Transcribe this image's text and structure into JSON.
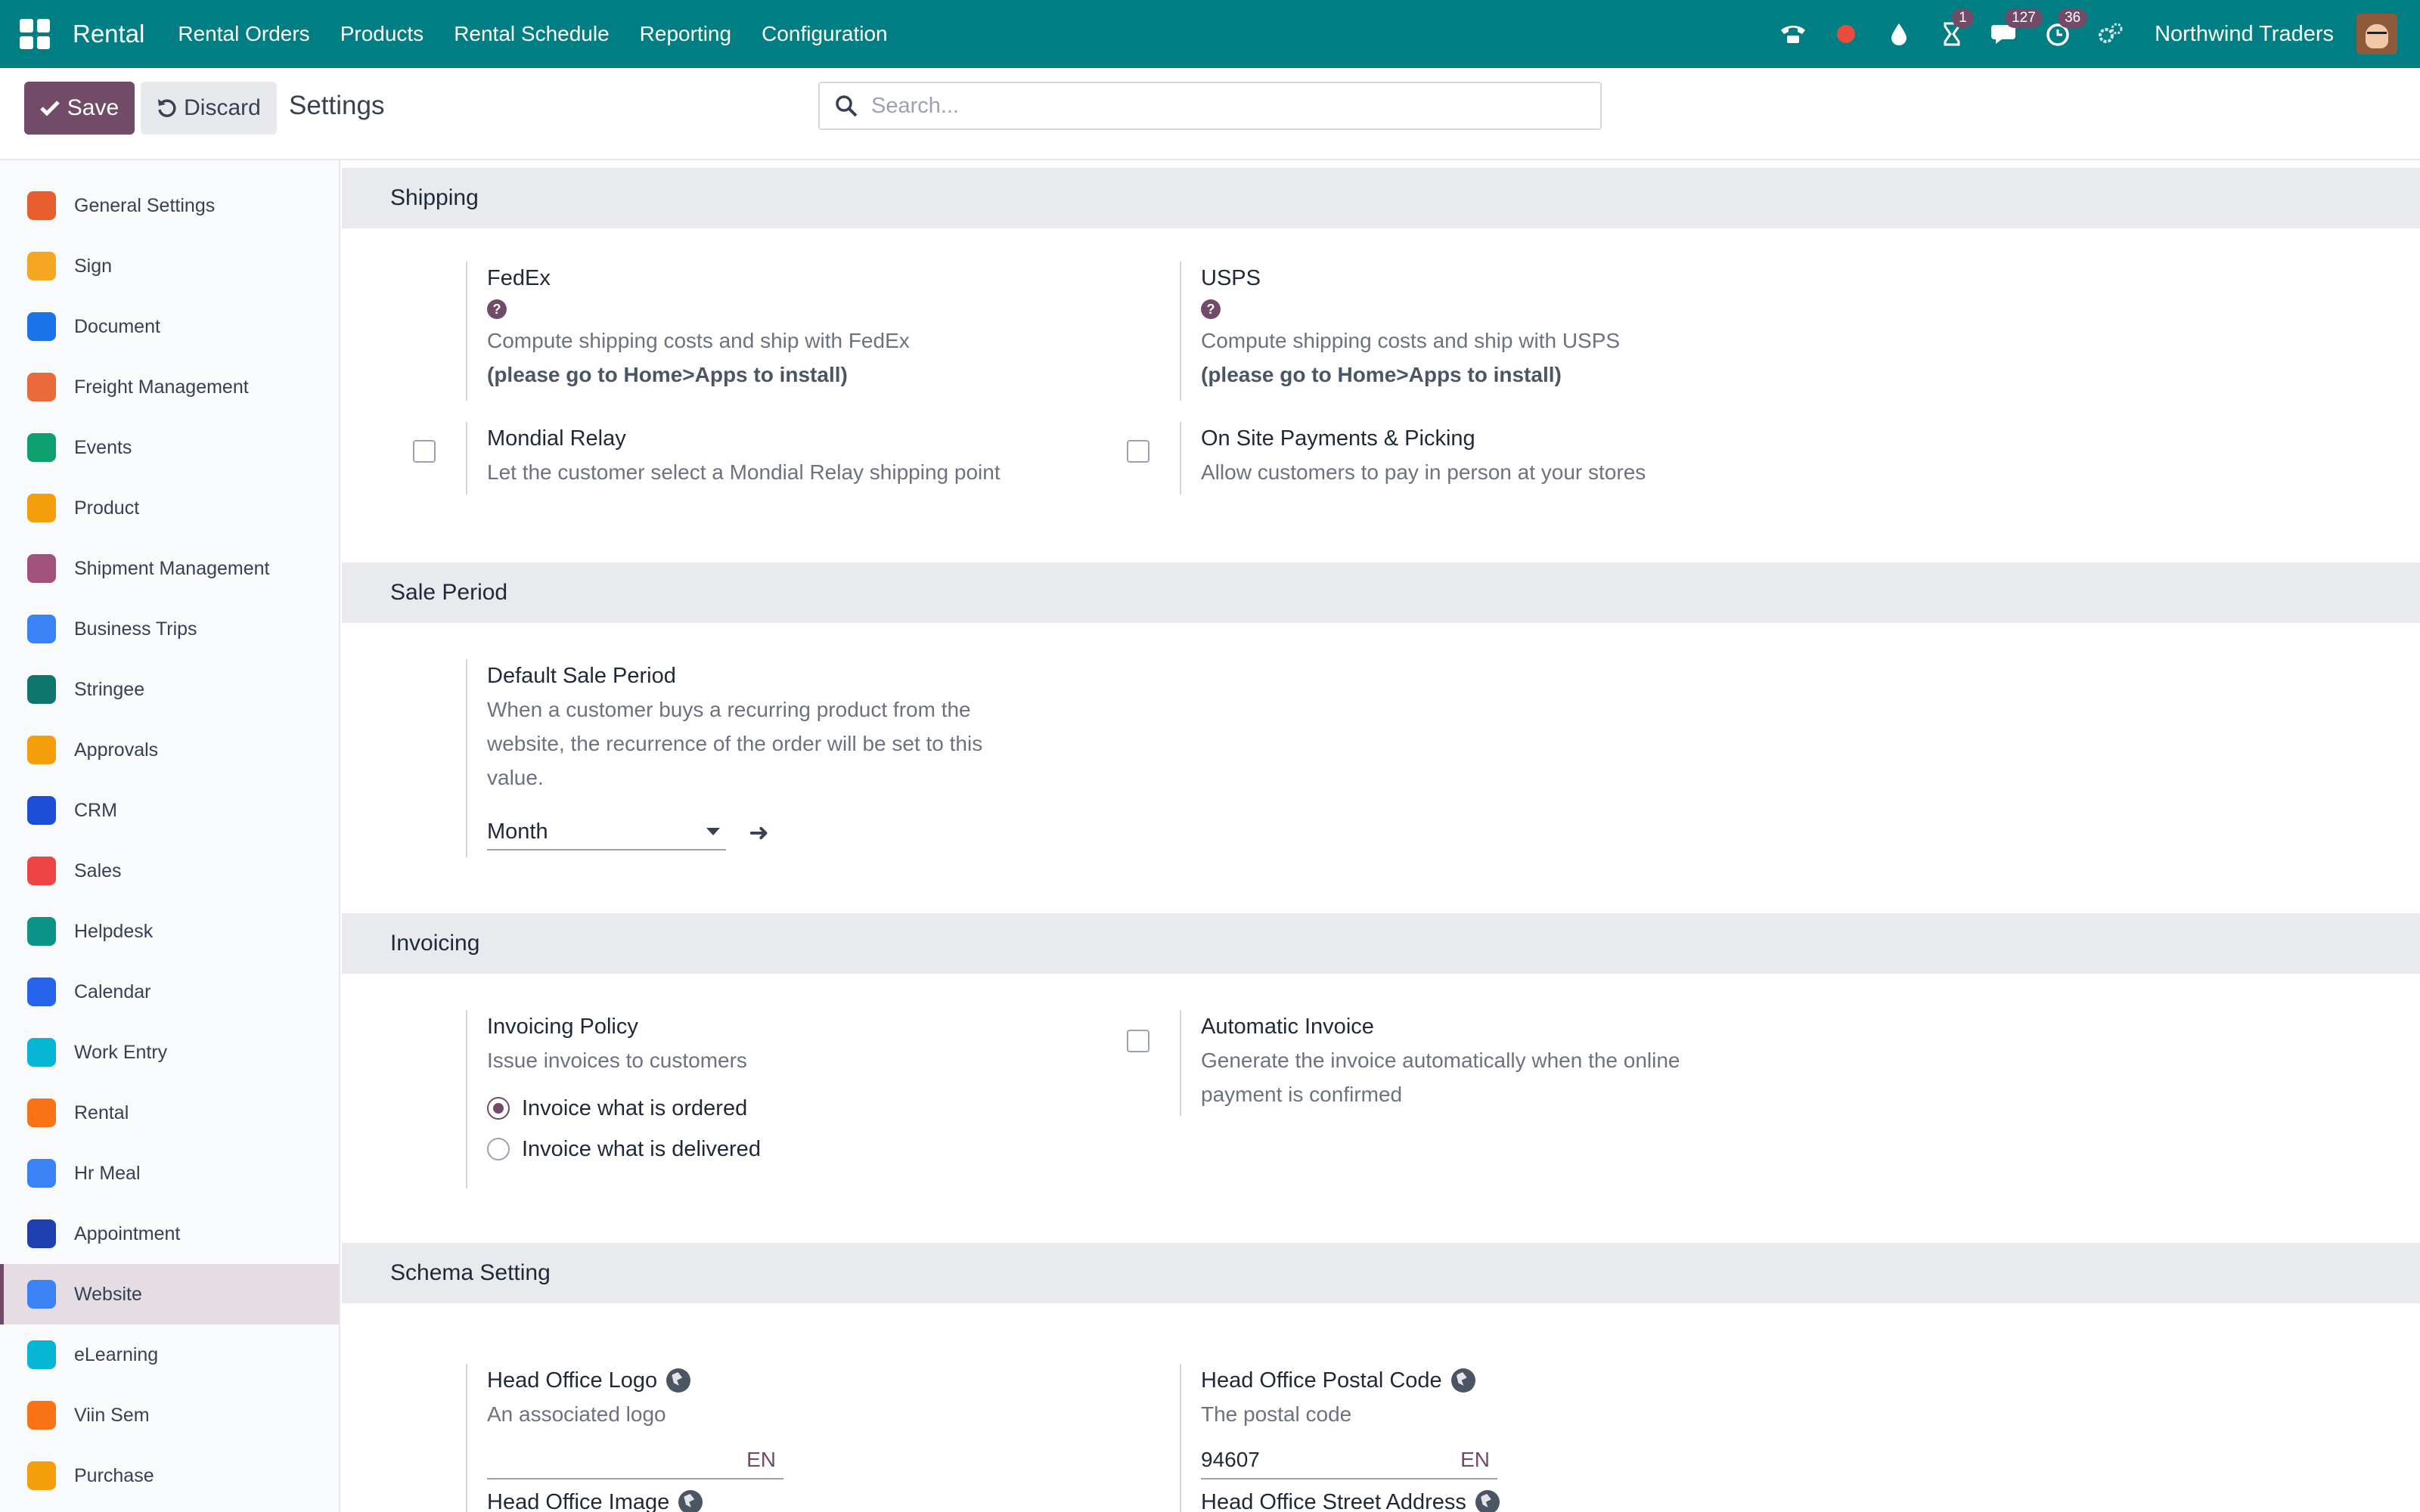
{
  "navbar": {
    "brand": "Rental",
    "menus": [
      "Rental Orders",
      "Products",
      "Rental Schedule",
      "Reporting",
      "Configuration"
    ],
    "badges": {
      "activities": "1",
      "messages": "127",
      "timer": "36"
    },
    "company": "Northwind Traders"
  },
  "control": {
    "save_label": "Save",
    "discard_label": "Discard",
    "title": "Settings",
    "search_placeholder": "Search..."
  },
  "sidebar": {
    "items": [
      {
        "label": "General Settings",
        "color": "#e85d2f"
      },
      {
        "label": "Sign",
        "color": "#f5a623"
      },
      {
        "label": "Document",
        "color": "#1a73e8"
      },
      {
        "label": "Freight Management",
        "color": "#e86a3b"
      },
      {
        "label": "Events",
        "color": "#0e9f6e"
      },
      {
        "label": "Product",
        "color": "#f59e0b"
      },
      {
        "label": "Shipment Management",
        "color": "#a0527c"
      },
      {
        "label": "Business Trips",
        "color": "#3b82f6"
      },
      {
        "label": "Stringee",
        "color": "#0f766e"
      },
      {
        "label": "Approvals",
        "color": "#f59e0b"
      },
      {
        "label": "CRM",
        "color": "#1d4ed8"
      },
      {
        "label": "Sales",
        "color": "#ef4444"
      },
      {
        "label": "Helpdesk",
        "color": "#0d9488"
      },
      {
        "label": "Calendar",
        "color": "#2563eb"
      },
      {
        "label": "Work Entry",
        "color": "#06b6d4"
      },
      {
        "label": "Rental",
        "color": "#f97316"
      },
      {
        "label": "Hr Meal",
        "color": "#3b82f6"
      },
      {
        "label": "Appointment",
        "color": "#1e40af"
      },
      {
        "label": "Website",
        "color": "#3b82f6"
      },
      {
        "label": "eLearning",
        "color": "#06b6d4"
      },
      {
        "label": "Viin Sem",
        "color": "#f97316"
      },
      {
        "label": "Purchase",
        "color": "#f59e0b"
      }
    ],
    "active": "Website"
  },
  "sections": {
    "shipping": {
      "title": "Shipping",
      "fedex": {
        "title": "FedEx",
        "desc": "Compute shipping costs and ship with FedEx",
        "note": "(please go to Home>Apps to install)"
      },
      "usps": {
        "title": "USPS",
        "desc": "Compute shipping costs and ship with USPS",
        "note": "(please go to Home>Apps to install)"
      },
      "mondial": {
        "title": "Mondial Relay",
        "desc": "Let the customer select a Mondial Relay shipping point"
      },
      "onsite": {
        "title": "On Site Payments & Picking",
        "desc": "Allow customers to pay in person at your stores"
      }
    },
    "sale_period": {
      "title": "Sale Period",
      "default": {
        "title": "Default Sale Period",
        "desc_lines": [
          "When a customer buys a recurring product from the",
          "website, the recurrence of the order will be set to this",
          "value."
        ],
        "value": "Month"
      }
    },
    "invoicing": {
      "title": "Invoicing",
      "policy": {
        "title": "Invoicing Policy",
        "desc": "Issue invoices to customers",
        "options": [
          "Invoice what is ordered",
          "Invoice what is delivered"
        ],
        "selected": "Invoice what is ordered"
      },
      "auto": {
        "title": "Automatic Invoice",
        "desc_lines": [
          "Generate the invoice automatically when the online",
          "payment is confirmed"
        ]
      }
    },
    "schema": {
      "title": "Schema Setting",
      "logo": {
        "title": "Head Office Logo",
        "desc": "An associated logo",
        "value": "",
        "lang": "EN"
      },
      "postal": {
        "title": "Head Office Postal Code",
        "desc": "The postal code",
        "value": "94607",
        "lang": "EN"
      },
      "image": {
        "title": "Head Office Image"
      },
      "street": {
        "title": "Head Office Street Address"
      }
    }
  }
}
